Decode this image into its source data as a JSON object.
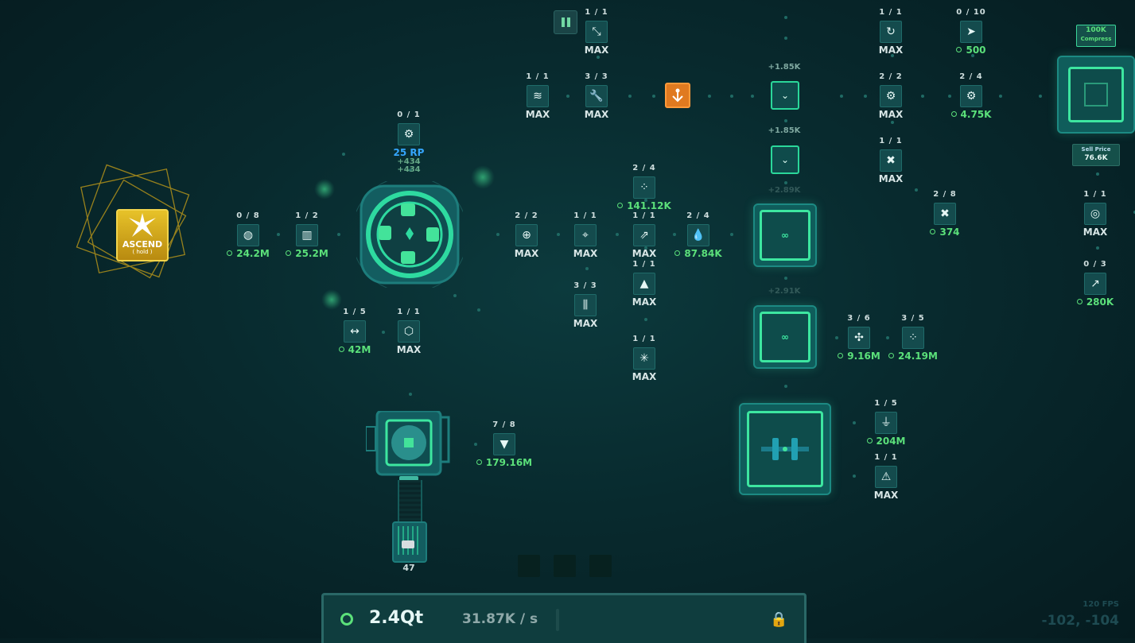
{
  "ascend": {
    "title": "ASCEND",
    "subtitle": "( hold )"
  },
  "compress": {
    "amount": "100K",
    "label": "Compress"
  },
  "sell_price": {
    "label": "Sell Price",
    "value": "76.6K"
  },
  "bonuses": {
    "b1": "+1.85K",
    "b2": "+1.85K",
    "b3": "+2.89K",
    "b4": "+2.91K"
  },
  "rp": {
    "count": "0 / 1",
    "value": "25 RP",
    "pop1": "+434",
    "pop2": "+434"
  },
  "nodes": {
    "n_left1": {
      "count": "0 / 8",
      "label": "24.2M",
      "icon": "pouch-icon"
    },
    "n_left2": {
      "count": "1 / 2",
      "label": "25.2M",
      "icon": "piano-icon"
    },
    "n_ll1": {
      "count": "1 / 5",
      "label": "42M",
      "icon": "width-icon"
    },
    "n_ll2": {
      "count": "1 / 1",
      "label": "MAX",
      "icon": "nodes-icon"
    },
    "n_top1": {
      "count": "1 / 1",
      "label": "MAX",
      "icon": "split-icon"
    },
    "n_wave": {
      "count": "1 / 1",
      "label": "MAX",
      "icon": "wave-icon"
    },
    "n_wrench": {
      "count": "3 / 3",
      "label": "MAX",
      "icon": "wrench-icon"
    },
    "n_refresh": {
      "count": "1 / 1",
      "label": "MAX",
      "icon": "refresh-icon"
    },
    "n_cursor": {
      "count": "0 / 10",
      "label": "500",
      "icon": "cursor-icon"
    },
    "n_gears1": {
      "count": "2 / 2",
      "label": "MAX",
      "icon": "gears-icon"
    },
    "n_gears2": {
      "count": "2 / 4",
      "label": "4.75K",
      "icon": "gears-icon"
    },
    "n_x1": {
      "count": "1 / 1",
      "label": "MAX",
      "icon": "cross-icon"
    },
    "n_x2": {
      "count": "2 / 8",
      "label": "374",
      "icon": "cross-icon"
    },
    "n_coins": {
      "count": "1 / 1",
      "label": "MAX",
      "icon": "coins-icon"
    },
    "n_chart": {
      "count": "0 / 3",
      "label": "280K",
      "icon": "chart-icon"
    },
    "n_target1": {
      "count": "2 / 2",
      "label": "MAX",
      "icon": "target-icon"
    },
    "n_target2": {
      "count": "1 / 1",
      "label": "MAX",
      "icon": "crosshair-icon"
    },
    "n_arrows": {
      "count": "1 / 1",
      "label": "MAX",
      "icon": "arrows-icon"
    },
    "n_dots": {
      "count": "2 / 4",
      "label": "141.12K",
      "icon": "dots-icon"
    },
    "n_drop": {
      "count": "2 / 4",
      "label": "87.84K",
      "icon": "drop-icon"
    },
    "n_weight": {
      "count": "1 / 1",
      "label": "MAX",
      "icon": "weight-icon"
    },
    "n_sliders": {
      "count": "3 / 3",
      "label": "MAX",
      "icon": "sliders-icon"
    },
    "n_burst": {
      "count": "1 / 1",
      "label": "MAX",
      "icon": "burst-icon"
    },
    "n_fan": {
      "count": "3 / 6",
      "label": "9.16M",
      "icon": "fan-icon"
    },
    "n_dots2": {
      "count": "3 / 5",
      "label": "24.19M",
      "icon": "dots-icon"
    },
    "n_plug": {
      "count": "1 / 5",
      "label": "204M",
      "icon": "plug-icon"
    },
    "n_warn": {
      "count": "1 / 1",
      "label": "MAX",
      "icon": "warning-icon"
    },
    "n_drill": {
      "count": "7 / 8",
      "label": "179.16M",
      "icon": "drill-icon"
    }
  },
  "storage": {
    "value": "47"
  },
  "bottom": {
    "total": "2.4Qt",
    "rate": "31.87K / s"
  },
  "fps": "120 FPS",
  "coords": "-102, -104",
  "colors": {
    "accent": "#3de6a0",
    "gold": "#e0b020",
    "value_green": "#5be07a",
    "rp_blue": "#35a6ff",
    "orange": "#e07a20"
  }
}
